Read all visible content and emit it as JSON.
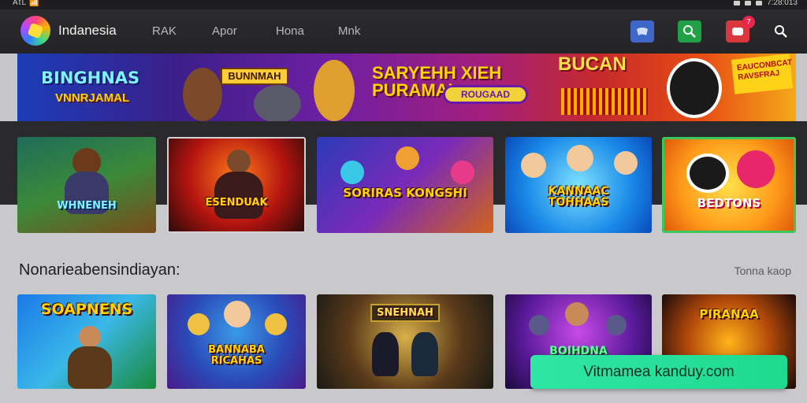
{
  "status_bar": {
    "left": "AtL 📶",
    "time": "7:28:013"
  },
  "header": {
    "brand": "Indanesia",
    "nav": [
      "RAK",
      "Apor",
      "Hona",
      "Mnk"
    ],
    "notification_count": "7"
  },
  "banner": {
    "left_title": "BINGHNAS",
    "left_sub": "VNNRJAMAL",
    "mid_title": "BUNNMAH",
    "center_title_line1": "SARYEHH XIEH",
    "center_title_line2": "PURAMAL",
    "center_pill": "ROUGAAD",
    "right_title": "BUCAN",
    "right_sticker": "EAUCONBCAT RAVSFRAJ"
  },
  "featured_games": [
    {
      "title": "WHNENEH"
    },
    {
      "title": "ESENDUAK"
    },
    {
      "title": "SORIRAS KONGSHI"
    },
    {
      "title": "KANNAAC TOHHAAS"
    },
    {
      "title": "BEDTONS"
    }
  ],
  "section": {
    "title": "Nonarieabensindiayan:",
    "link": "Tonna kaop"
  },
  "section_games": [
    {
      "title": "SOAPNENS"
    },
    {
      "title": "BANNABA RICAHAS"
    },
    {
      "title": "SNEHNAH"
    },
    {
      "title": "BOIHDNA"
    },
    {
      "title": "PIRANAA"
    }
  ],
  "cta": {
    "label": "Vitmamea kanduy.com"
  },
  "colors": {
    "accent_green": "#1fd98f",
    "badge_red": "#e8264a",
    "header_bg": "#2b2b2d"
  }
}
